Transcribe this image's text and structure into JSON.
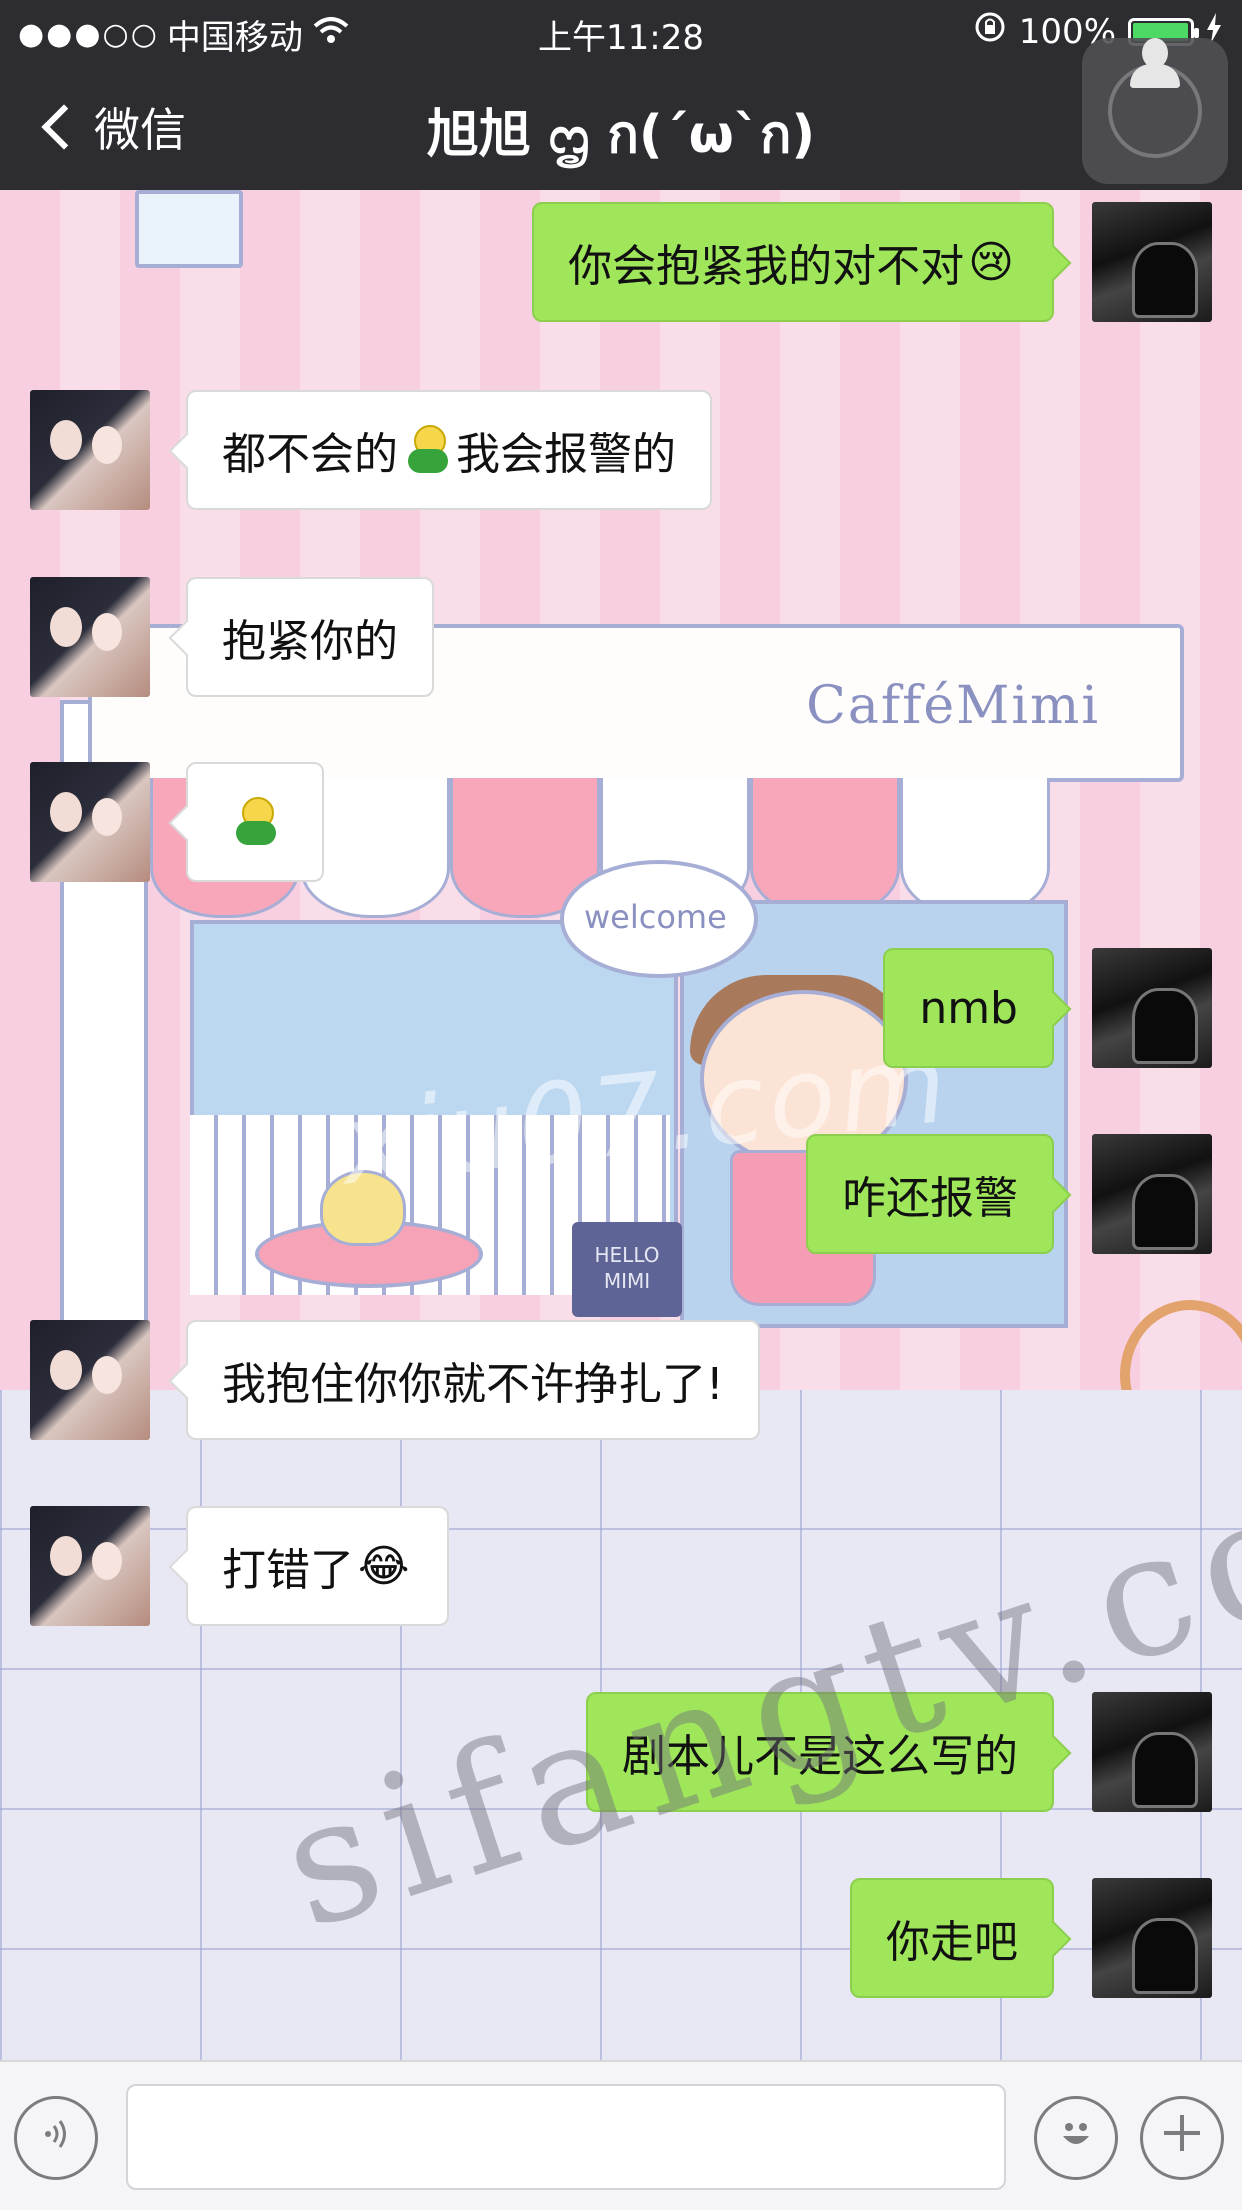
{
  "status_bar": {
    "signal": "●●●○○",
    "carrier": "中国移动",
    "wifi_icon": "wifi-icon",
    "time": "上午11:28",
    "battery_percent": "100%",
    "battery_level": 1.0
  },
  "nav": {
    "back_label": "微信",
    "title": "旭旭 ᦗ ก(ˊωˋก)"
  },
  "wallpaper": {
    "shop_sign": "CafféMimi",
    "welcome": "welcome",
    "hello_sign": "HELLO MIMI"
  },
  "watermarks": {
    "center": "xiu07.com",
    "bottom": "sifangtv.com"
  },
  "messages": [
    {
      "from": "me",
      "text": "你会抱紧我的对不对",
      "emoji": "😢"
    },
    {
      "from": "them",
      "text_before": "都不会的",
      "emoji": "green-hug-emoji",
      "text_after": "我会报警的"
    },
    {
      "from": "them",
      "text": "抱紧你的"
    },
    {
      "from": "them",
      "emoji": "green-hug-emoji"
    },
    {
      "from": "me",
      "text": "nmb"
    },
    {
      "from": "me",
      "text": "咋还报警"
    },
    {
      "from": "them",
      "text": "我抱住你你就不许挣扎了!"
    },
    {
      "from": "them",
      "text": "打错了",
      "emoji": "😂"
    },
    {
      "from": "me",
      "text": "剧本儿不是这么写的"
    },
    {
      "from": "me",
      "text": "你走吧"
    }
  ],
  "input_bar": {
    "voice_icon": "voice-icon",
    "emoji_icon": "smiley-icon",
    "plus_icon": "plus-icon",
    "placeholder": ""
  },
  "colors": {
    "nav_bg": "#2d2c31",
    "my_bubble": "#9fe65b",
    "their_bubble": "#ffffff",
    "battery": "#4cd964"
  }
}
